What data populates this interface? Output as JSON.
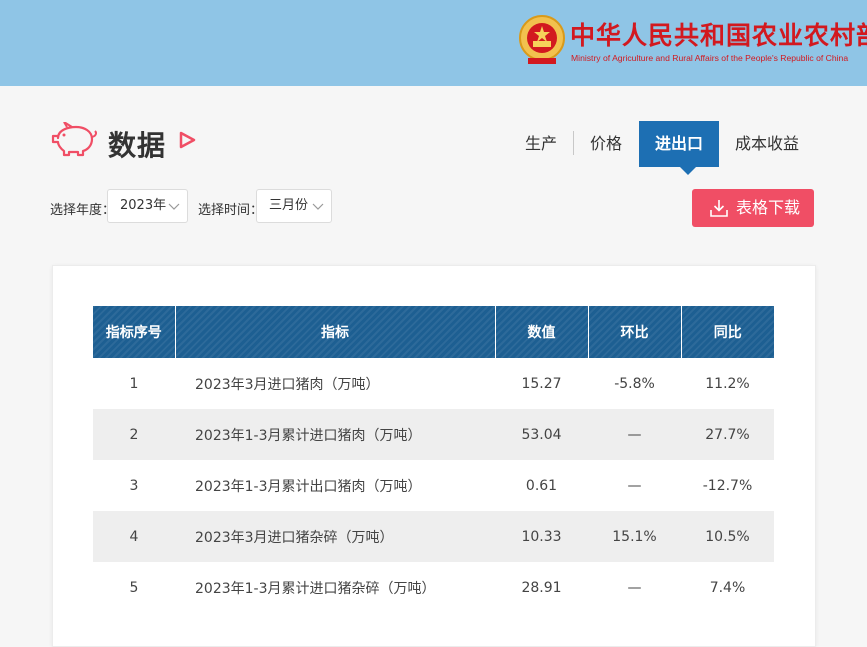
{
  "header": {
    "ministry_cn": "中华人民共和国农业农村部",
    "ministry_en": "Ministry of Agriculture and Rural Affairs of the People's Republic of China",
    "colors": {
      "banner": "#8fc5e6",
      "ministry_text": "#d2191f"
    }
  },
  "page": {
    "title": "数据",
    "icons": {
      "title_icon": "pig-icon",
      "title_marker": "play-triangle-icon"
    }
  },
  "tabs": [
    {
      "label": "生产",
      "active": false
    },
    {
      "label": "价格",
      "active": false
    },
    {
      "label": "进出口",
      "active": true
    },
    {
      "label": "成本收益",
      "active": false
    }
  ],
  "filters": {
    "year_label": "选择年度：",
    "year_value": "2023年",
    "time_label": "选择时间：",
    "time_value": "三月份"
  },
  "download": {
    "label": "表格下载",
    "icon": "download-icon",
    "color": "#f04e65"
  },
  "table": {
    "columns": [
      "指标序号",
      "指标",
      "数值",
      "环比",
      "同比"
    ],
    "rows": [
      [
        "1",
        "2023年3月进口猪肉（万吨）",
        "15.27",
        "-5.8%",
        "11.2%"
      ],
      [
        "2",
        "2023年1-3月累计进口猪肉（万吨）",
        "53.04",
        "—",
        "27.7%"
      ],
      [
        "3",
        "2023年1-3月累计出口猪肉（万吨）",
        "0.61",
        "—",
        "-12.7%"
      ],
      [
        "4",
        "2023年3月进口猪杂碎（万吨）",
        "10.33",
        "15.1%",
        "10.5%"
      ],
      [
        "5",
        "2023年1-3月累计进口猪杂碎（万吨）",
        "28.91",
        "—",
        "7.4%"
      ]
    ],
    "header_color": "#1d5f92",
    "active_tab_color": "#1d6fb3"
  }
}
